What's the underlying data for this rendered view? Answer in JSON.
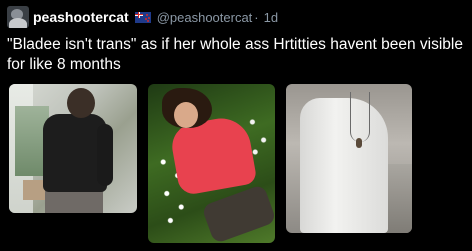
{
  "tweet": {
    "display_name": "peashootercat",
    "flag_icon": "australia-flag-icon",
    "handle": "@peashootercat",
    "separator": "·",
    "time": "1d",
    "text": "\"Bladee isn't trans\" as if her whole ass Hrtitties havent been visible for like 8 months"
  },
  "media": [
    {
      "name": "photo-1",
      "icon": "person-black-jacket-photo"
    },
    {
      "name": "photo-2",
      "icon": "person-red-sweater-in-grass-photo"
    },
    {
      "name": "photo-3",
      "icon": "person-white-shirt-chain-photo"
    }
  ],
  "colors": {
    "background": "#000000",
    "text": "#ffffff",
    "muted": "#8b98a5"
  }
}
